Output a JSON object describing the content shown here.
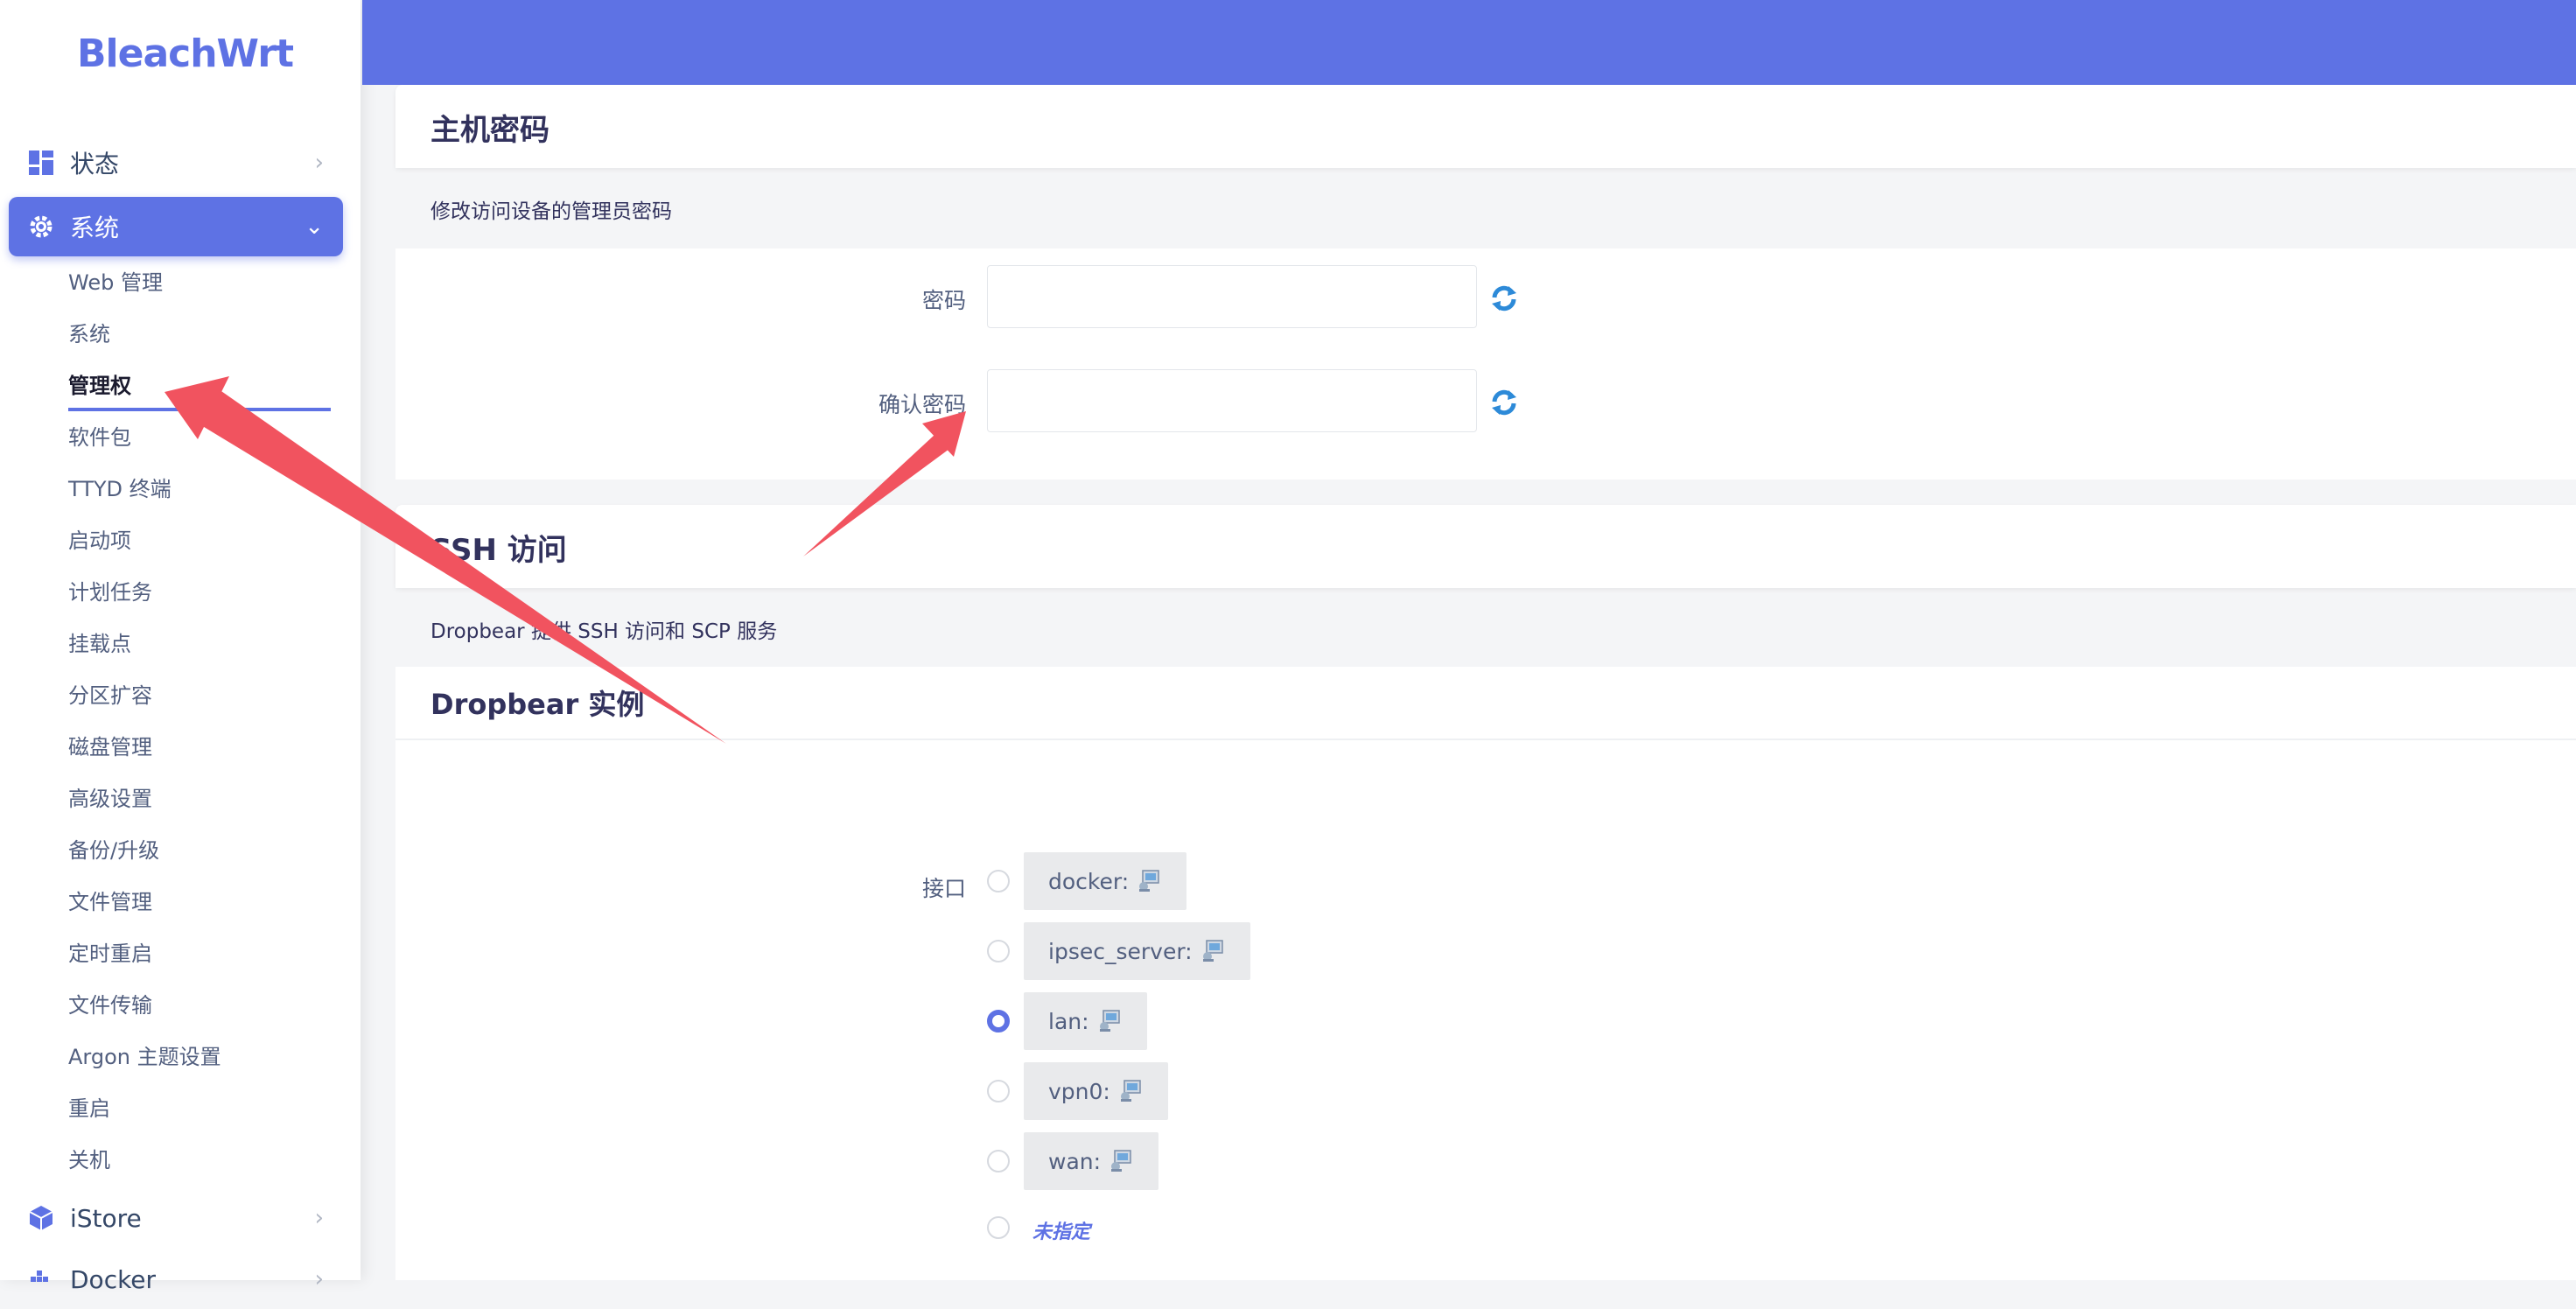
{
  "brand": "BleachWrt",
  "sidebar": {
    "top_items": [
      {
        "label": "状态"
      },
      {
        "label": "系统"
      }
    ],
    "sub_items": [
      "Web 管理",
      "系统",
      "管理权",
      "软件包",
      "TTYD 终端",
      "启动项",
      "计划任务",
      "挂载点",
      "分区扩容",
      "磁盘管理",
      "高级设置",
      "备份/升级",
      "文件管理",
      "定时重启",
      "文件传输",
      "Argon 主题设置",
      "重启",
      "关机"
    ],
    "bottom_items": [
      {
        "label": "iStore"
      },
      {
        "label": "Docker"
      }
    ]
  },
  "password_section": {
    "title": "主机密码",
    "description": "修改访问设备的管理员密码",
    "password_label": "密码",
    "confirm_label": "确认密码",
    "password_value": "",
    "confirm_value": ""
  },
  "ssh_section": {
    "title": "SSH 访问",
    "description": "Dropbear 提供 SSH 访问和 SCP 服务",
    "instance_title": "Dropbear 实例",
    "interface_label": "接口",
    "interfaces": [
      {
        "name": "docker:",
        "checked": false
      },
      {
        "name": "ipsec_server:",
        "checked": false
      },
      {
        "name": "lan:",
        "checked": true
      },
      {
        "name": "vpn0:",
        "checked": false
      },
      {
        "name": "wan:",
        "checked": false
      }
    ],
    "unspecified_label": "未指定"
  },
  "colors": {
    "accent": "#5e72e4",
    "annotation_arrow": "#f1535f"
  }
}
